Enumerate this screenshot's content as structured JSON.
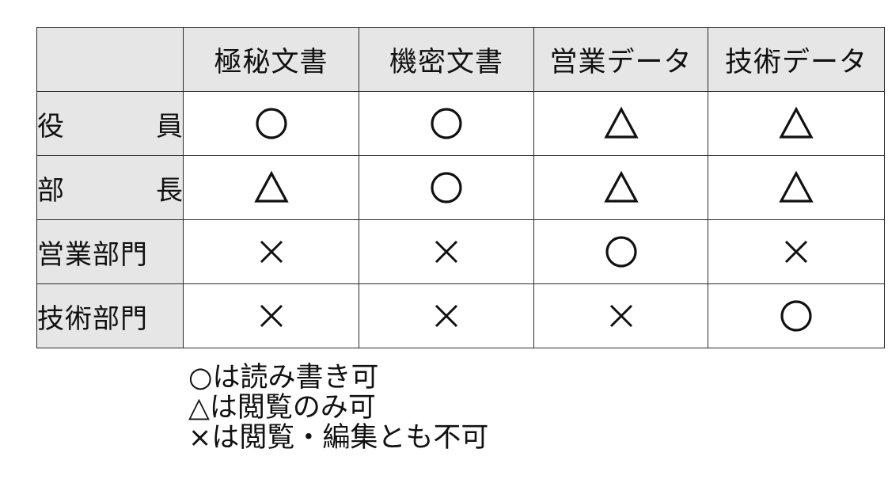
{
  "table": {
    "columns": [
      "極秘文書",
      "機密文書",
      "営業データ",
      "技術データ"
    ],
    "rows": [
      {
        "role": "役　員",
        "marks": [
          "circle",
          "circle",
          "triangle",
          "triangle"
        ]
      },
      {
        "role": "部　長",
        "marks": [
          "triangle",
          "circle",
          "triangle",
          "triangle"
        ]
      },
      {
        "role": "営業部門",
        "marks": [
          "cross",
          "cross",
          "circle",
          "cross"
        ]
      },
      {
        "role": "技術部門",
        "marks": [
          "cross",
          "cross",
          "cross",
          "circle"
        ]
      }
    ],
    "mark_icons": {
      "circle": "circle-icon",
      "triangle": "triangle-icon",
      "cross": "cross-icon"
    },
    "colors": {
      "header_background": "#e6e6e6",
      "border": "#2a2a2a",
      "mark": "#111111"
    }
  },
  "legend": [
    "○は読み書き可",
    "△は閲覧のみ可",
    "×は閲覧・編集とも不可"
  ]
}
